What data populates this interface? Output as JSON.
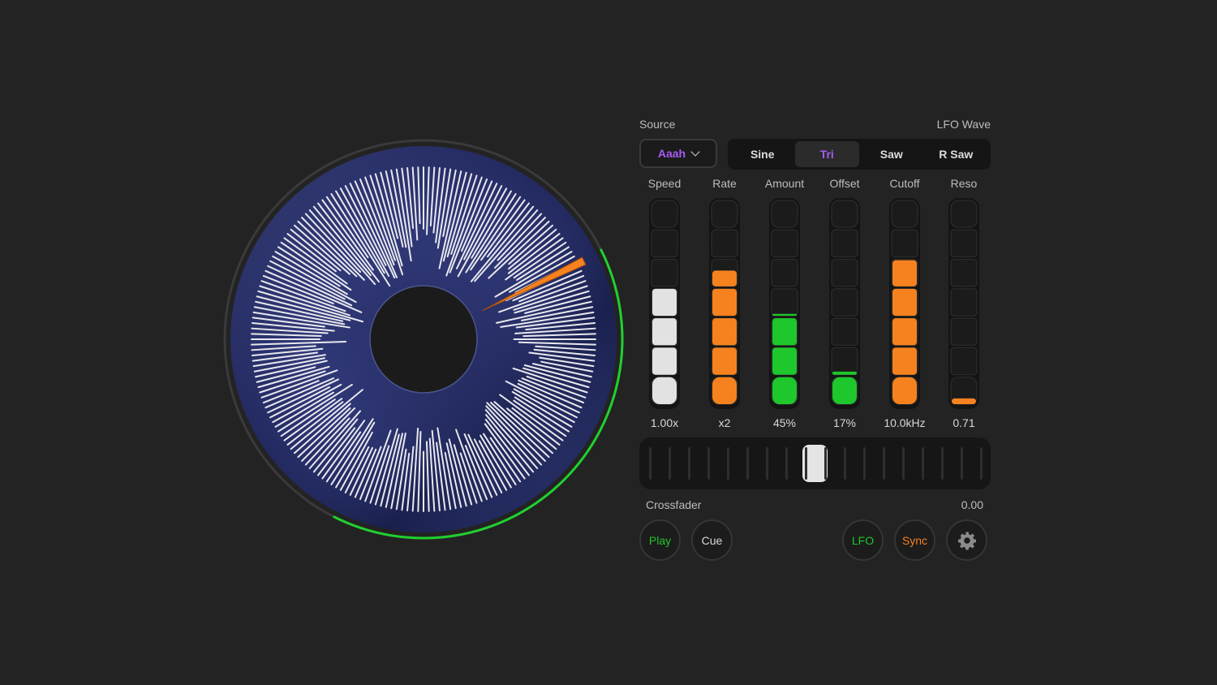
{
  "turntable": {
    "progress": 0.4,
    "accent_ring_color": "#1fd12e",
    "needle_color": "#f5821f"
  },
  "panel": {
    "source_label": "Source",
    "source_value": "Aaah",
    "lfo_wave_label": "LFO Wave",
    "lfo_wave_options": [
      "Sine",
      "Tri",
      "Saw",
      "R Saw"
    ],
    "lfo_wave_selected": "Tri",
    "accent_color": "#a65bf5"
  },
  "meters": [
    {
      "label": "Speed",
      "value": "1.00x",
      "level": 0.58,
      "color": "#e2e2e2"
    },
    {
      "label": "Rate",
      "value": "x2",
      "level": 0.66,
      "color": "#f5821f"
    },
    {
      "label": "Amount",
      "value": "45%",
      "level": 0.45,
      "color": "#1ec72b"
    },
    {
      "label": "Offset",
      "value": "17%",
      "level": 0.17,
      "color": "#1ec72b"
    },
    {
      "label": "Cutoff",
      "value": "10.0kHz",
      "level": 0.71,
      "color": "#f5821f"
    },
    {
      "label": "Reso",
      "value": "0.71",
      "level": 0.04,
      "color": "#f5821f"
    }
  ],
  "crossfader": {
    "label": "Crossfader",
    "value": "0.00",
    "position": 0.5
  },
  "buttons": {
    "play": {
      "label": "Play",
      "color": "#1ec72b"
    },
    "cue": {
      "label": "Cue",
      "color": "#d8d8d8"
    },
    "lfo": {
      "label": "LFO",
      "color": "#1ec72b"
    },
    "sync": {
      "label": "Sync",
      "color": "#f5821f"
    },
    "settings_icon": "gear-icon"
  }
}
